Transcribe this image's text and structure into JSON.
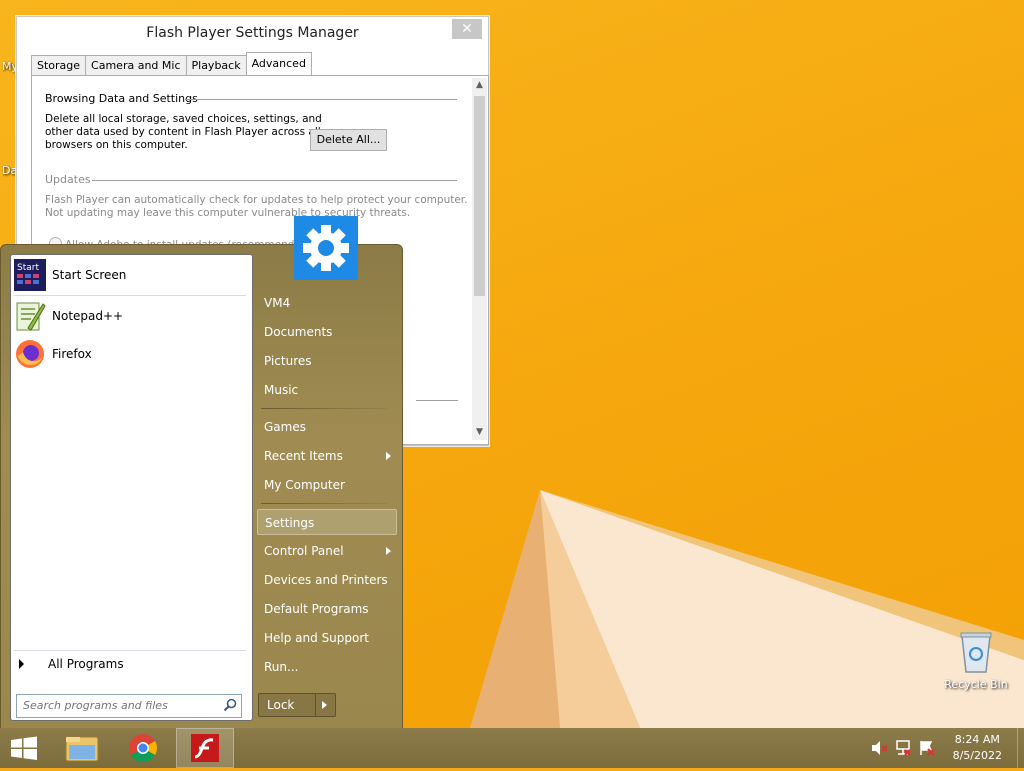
{
  "desktop": {
    "icons": [
      {
        "label": "My"
      },
      {
        "label": "Da"
      }
    ],
    "recycle_bin": "Recycle Bin"
  },
  "flash_window": {
    "title": "Flash Player Settings Manager",
    "close_glyph": "✕",
    "tabs": [
      "Storage",
      "Camera and Mic",
      "Playback",
      "Advanced"
    ],
    "active_tab": "Advanced",
    "browsing": {
      "heading": "Browsing Data and Settings",
      "description_lines": [
        "Delete all local storage, saved choices, settings, and",
        "other data used by content in Flash Player across all",
        "browsers on this computer."
      ],
      "button": "Delete All..."
    },
    "updates": {
      "heading": "Updates",
      "description_lines": [
        "Flash Player can automatically check for updates to help protect your computer.",
        "Not updating may leave this computer vulnerable to security threats."
      ],
      "option": "Allow Adobe to install updates (recommended)"
    }
  },
  "start_menu": {
    "pinned": [
      {
        "label": "Start Screen",
        "icon": "start-screen-icon"
      },
      {
        "label": "Notepad++",
        "icon": "notepadpp-icon"
      },
      {
        "label": "Firefox",
        "icon": "firefox-icon"
      }
    ],
    "all_programs": "All Programs",
    "search_placeholder": "Search programs and files",
    "right_items": [
      {
        "label": "VM4"
      },
      {
        "label": "Documents"
      },
      {
        "label": "Pictures"
      },
      {
        "label": "Music"
      },
      {
        "label": "Games"
      },
      {
        "label": "Recent Items",
        "submenu": true
      },
      {
        "label": "My Computer"
      },
      {
        "label": "Settings",
        "highlighted": true
      },
      {
        "label": "Control Panel",
        "submenu": true
      },
      {
        "label": "Devices and Printers"
      },
      {
        "label": "Default Programs"
      },
      {
        "label": "Help and Support"
      },
      {
        "label": "Run..."
      }
    ],
    "lock_label": "Lock",
    "settings_tile_icon": "gear-icon"
  },
  "taskbar": {
    "buttons": [
      "windows-logo-icon",
      "file-explorer-icon",
      "chrome-icon",
      "flash-player-icon"
    ],
    "active_button": "flash-player-icon",
    "tray_icons": [
      "volume-muted-icon",
      "network-icon",
      "action-center-flag-icon"
    ],
    "time": "8:24 AM",
    "date": "8/5/2022"
  },
  "colors": {
    "desktop": "#f5a70d",
    "start_menu": "#9a874e",
    "settings_tile": "#1e8ae6"
  }
}
